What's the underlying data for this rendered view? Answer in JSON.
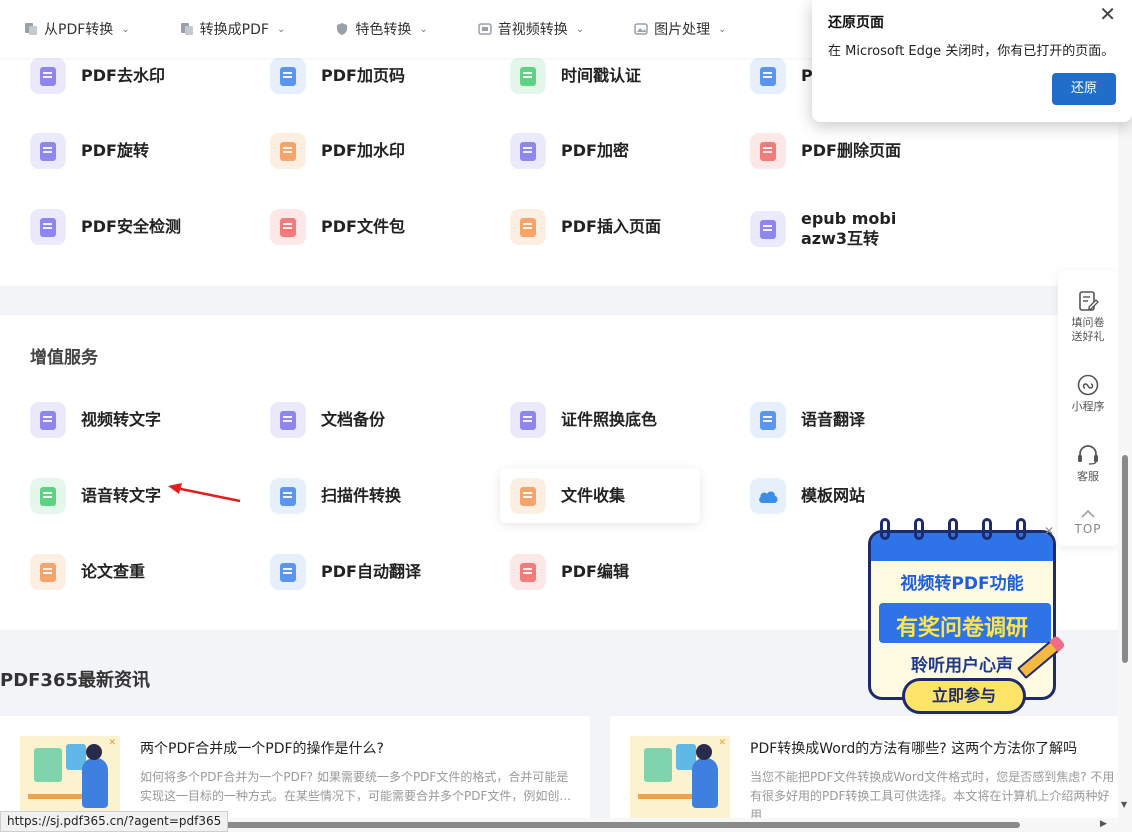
{
  "nav": {
    "items": [
      {
        "label": "从PDF转换",
        "icon": "document-convert-icon"
      },
      {
        "label": "转换成PDF",
        "icon": "document-convert-icon"
      },
      {
        "label": "特色转换",
        "icon": "shield-star-icon"
      },
      {
        "label": "音视频转换",
        "icon": "media-icon"
      },
      {
        "label": "图片处理",
        "icon": "image-icon"
      }
    ]
  },
  "tools_top": [
    {
      "label": "PDF去水印",
      "color": "purple"
    },
    {
      "label": "PDF加页码",
      "color": "blue"
    },
    {
      "label": "时间戳认证",
      "color": "green"
    },
    {
      "label": "P",
      "color": "blue"
    },
    {
      "label": "PDF旋转",
      "color": "purple"
    },
    {
      "label": "PDF加水印",
      "color": "orange"
    },
    {
      "label": "PDF加密",
      "color": "purple"
    },
    {
      "label": "PDF删除页面",
      "color": "red"
    },
    {
      "label": "PDF安全检测",
      "color": "purple"
    },
    {
      "label": "PDF文件包",
      "color": "red"
    },
    {
      "label": "PDF插入页面",
      "color": "orange"
    },
    {
      "label": "epub mobi\nazw3互转",
      "color": "purple"
    }
  ],
  "value_added": {
    "title": "增值服务",
    "tools": [
      {
        "label": "视频转文字",
        "color": "purple"
      },
      {
        "label": "文档备份",
        "color": "purple"
      },
      {
        "label": "证件照换底色",
        "color": "purple"
      },
      {
        "label": "语音翻译",
        "color": "blue"
      },
      {
        "label": "语音转文字",
        "color": "green"
      },
      {
        "label": "扫描件转换",
        "color": "blue"
      },
      {
        "label": "文件收集",
        "color": "orange"
      },
      {
        "label": "模板网站",
        "color": "blue"
      },
      {
        "label": "论文查重",
        "color": "orange"
      },
      {
        "label": "PDF自动翻译",
        "color": "blue"
      },
      {
        "label": "PDF编辑",
        "color": "red"
      }
    ]
  },
  "news": {
    "title": "PDF365最新资讯",
    "items": [
      {
        "title": "两个PDF合并成一个PDF的操作是什么?",
        "summary": "如何将多个PDF合并为一个PDF? 如果需要统一多个PDF文件的格式，合并可能是\n实现这一目标的一种方式。在某些情况下，可能需要合并多个PDF文件，例如创..."
      },
      {
        "title": "PDF转换成Word的方法有哪些? 这两个方法你了解吗",
        "summary": "当您不能把PDF文件转换成Word文件格式时，您是否感到焦虑? 不用\n有很多好用的PDF转换工具可供选择。本文将在计算机上介绍两种好用"
      }
    ]
  },
  "floatbar": {
    "survey": "填问卷\n送好礼",
    "miniprogram": "小程序",
    "service": "客服",
    "top": "TOP"
  },
  "promo": {
    "line1": "视频转PDF功能",
    "line2": "有奖问卷调研",
    "line3": "聆听用户心声",
    "button": "立即参与"
  },
  "edge_popup": {
    "title": "还原页面",
    "text": "在 Microsoft Edge 关闭时，你有已打开的页面。",
    "button": "还原"
  },
  "status_url": "https://sj.pdf365.cn/?agent=pdf365",
  "colors": {
    "accent_blue": "#1f6fc9",
    "arrow_red": "#e02020",
    "promo_blue": "#2e74e8",
    "promo_yellow": "#ffe44d"
  }
}
